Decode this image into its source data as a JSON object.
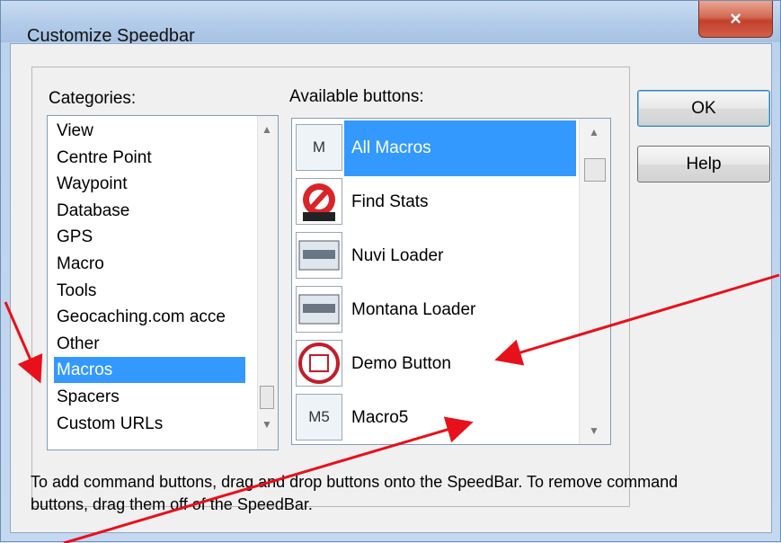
{
  "window": {
    "title": "Customize Speedbar",
    "close_glyph": "×"
  },
  "categories": {
    "label": "Categories:",
    "items": [
      {
        "label": "View",
        "selected": false
      },
      {
        "label": "Centre Point",
        "selected": false
      },
      {
        "label": "Waypoint",
        "selected": false
      },
      {
        "label": "Database",
        "selected": false
      },
      {
        "label": "GPS",
        "selected": false
      },
      {
        "label": "Macro",
        "selected": false
      },
      {
        "label": "Tools",
        "selected": false
      },
      {
        "label": "Geocaching.com acce",
        "selected": false
      },
      {
        "label": "Other",
        "selected": false
      },
      {
        "label": "Macros",
        "selected": true
      },
      {
        "label": "Spacers",
        "selected": false
      },
      {
        "label": "Custom URLs",
        "selected": false
      }
    ]
  },
  "available": {
    "label": "Available buttons:",
    "items": [
      {
        "label": "All Macros",
        "thumb": "M",
        "icon": "macro-m-icon",
        "selected": true
      },
      {
        "label": "Find Stats",
        "thumb": "",
        "icon": "find-stats-icon",
        "selected": false
      },
      {
        "label": "Nuvi Loader",
        "thumb": "",
        "icon": "nuvi-loader-icon",
        "selected": false
      },
      {
        "label": "Montana Loader",
        "thumb": "",
        "icon": "montana-loader-icon",
        "selected": false
      },
      {
        "label": "Demo Button",
        "thumb": "",
        "icon": "loc-icon",
        "selected": false
      },
      {
        "label": "Macro5",
        "thumb": "M5",
        "icon": "macro-m5-icon",
        "selected": false
      }
    ]
  },
  "buttons": {
    "ok": "OK",
    "help": "Help"
  },
  "footer": "To add command buttons, drag and drop buttons onto the SpeedBar. To remove command buttons, drag them off of the SpeedBar.",
  "colors": {
    "selection": "#3399ff",
    "annotation_arrow": "#e8101a"
  }
}
